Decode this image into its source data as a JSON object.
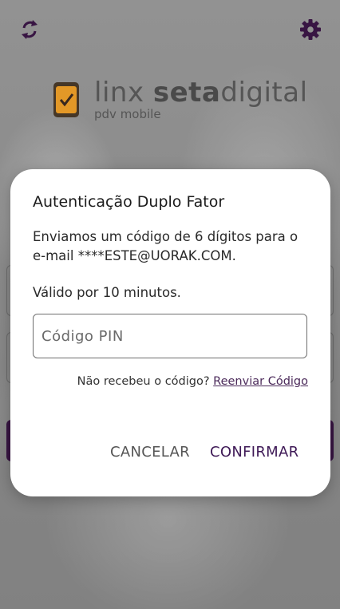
{
  "colors": {
    "accent": "#3b1747",
    "link": "#4b2a5a",
    "logo_orange": "#f0a12a"
  },
  "icons": {
    "refresh": "refresh-icon",
    "settings": "gear-icon"
  },
  "logo": {
    "word1": "linx ",
    "word2": "seta",
    "word3": "digital",
    "subtitle": "pdv mobile"
  },
  "dialog": {
    "title": "Autenticação Duplo Fator",
    "message": "Enviamos um código de 6 dígitos para o e-mail ****ESTE@UORAK.COM.",
    "validity": "Válido por 10 minutos.",
    "pin": {
      "placeholder": "Código PIN",
      "value": ""
    },
    "resend_prompt": "Não recebeu o código?",
    "resend_link": "Reenviar Código",
    "cancel_label": "CANCELAR",
    "confirm_label": "CONFIRMAR"
  }
}
